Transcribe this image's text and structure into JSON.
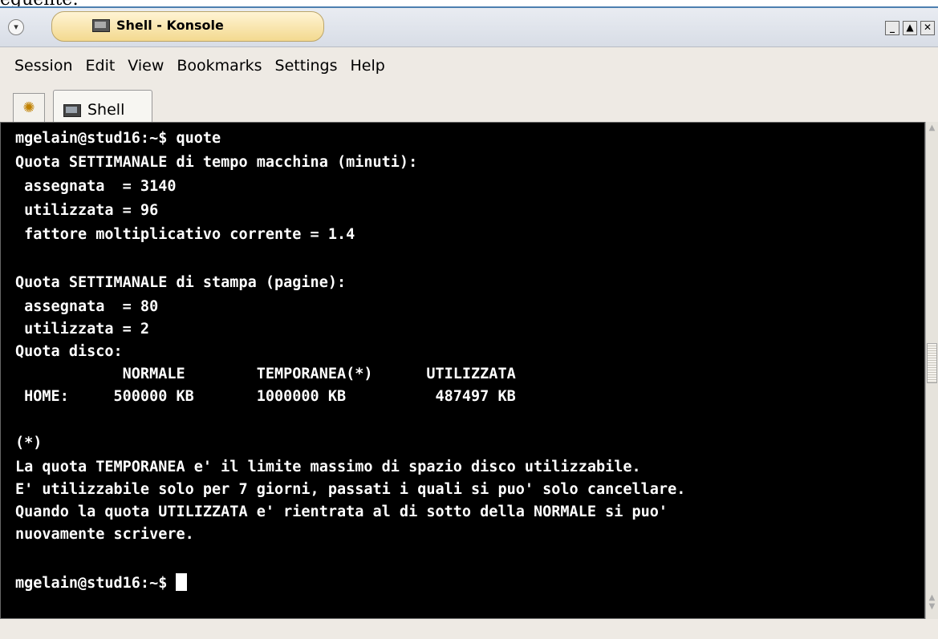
{
  "caption_fragment": "eguente:",
  "window": {
    "title": "Shell - Konsole",
    "menu_glyph": "▾",
    "buttons": {
      "minimize": "_",
      "maximize": "▲",
      "close": "✕"
    }
  },
  "menubar": {
    "items": [
      "Session",
      "Edit",
      "View",
      "Bookmarks",
      "Settings",
      "Help"
    ]
  },
  "tabs": {
    "new_tab_glyph": "✺",
    "active_label": "Shell"
  },
  "terminal": {
    "lines": [
      "mgelain@stud16:~$ quote",
      "Quota SETTIMANALE di tempo macchina (minuti):",
      " assegnata  = 3140",
      " utilizzata = 96",
      " fattore moltiplicativo corrente = 1.4",
      "",
      "Quota SETTIMANALE di stampa (pagine):",
      " assegnata  = 80",
      " utilizzata = 2",
      "Quota disco:",
      "            NORMALE        TEMPORANEA(*)      UTILIZZATA",
      " HOME:     500000 KB       1000000 KB          487497 KB",
      "",
      "(*)",
      "La quota TEMPORANEA e' il limite massimo di spazio disco utilizzabile.",
      "E' utilizzabile solo per 7 giorni, passati i quali si puo' solo cancellare.",
      "Quando la quota UTILIZZATA e' rientrata al di sotto della NORMALE si puo'",
      "nuovamente scrivere.",
      "",
      "mgelain@stud16:~$ "
    ]
  }
}
